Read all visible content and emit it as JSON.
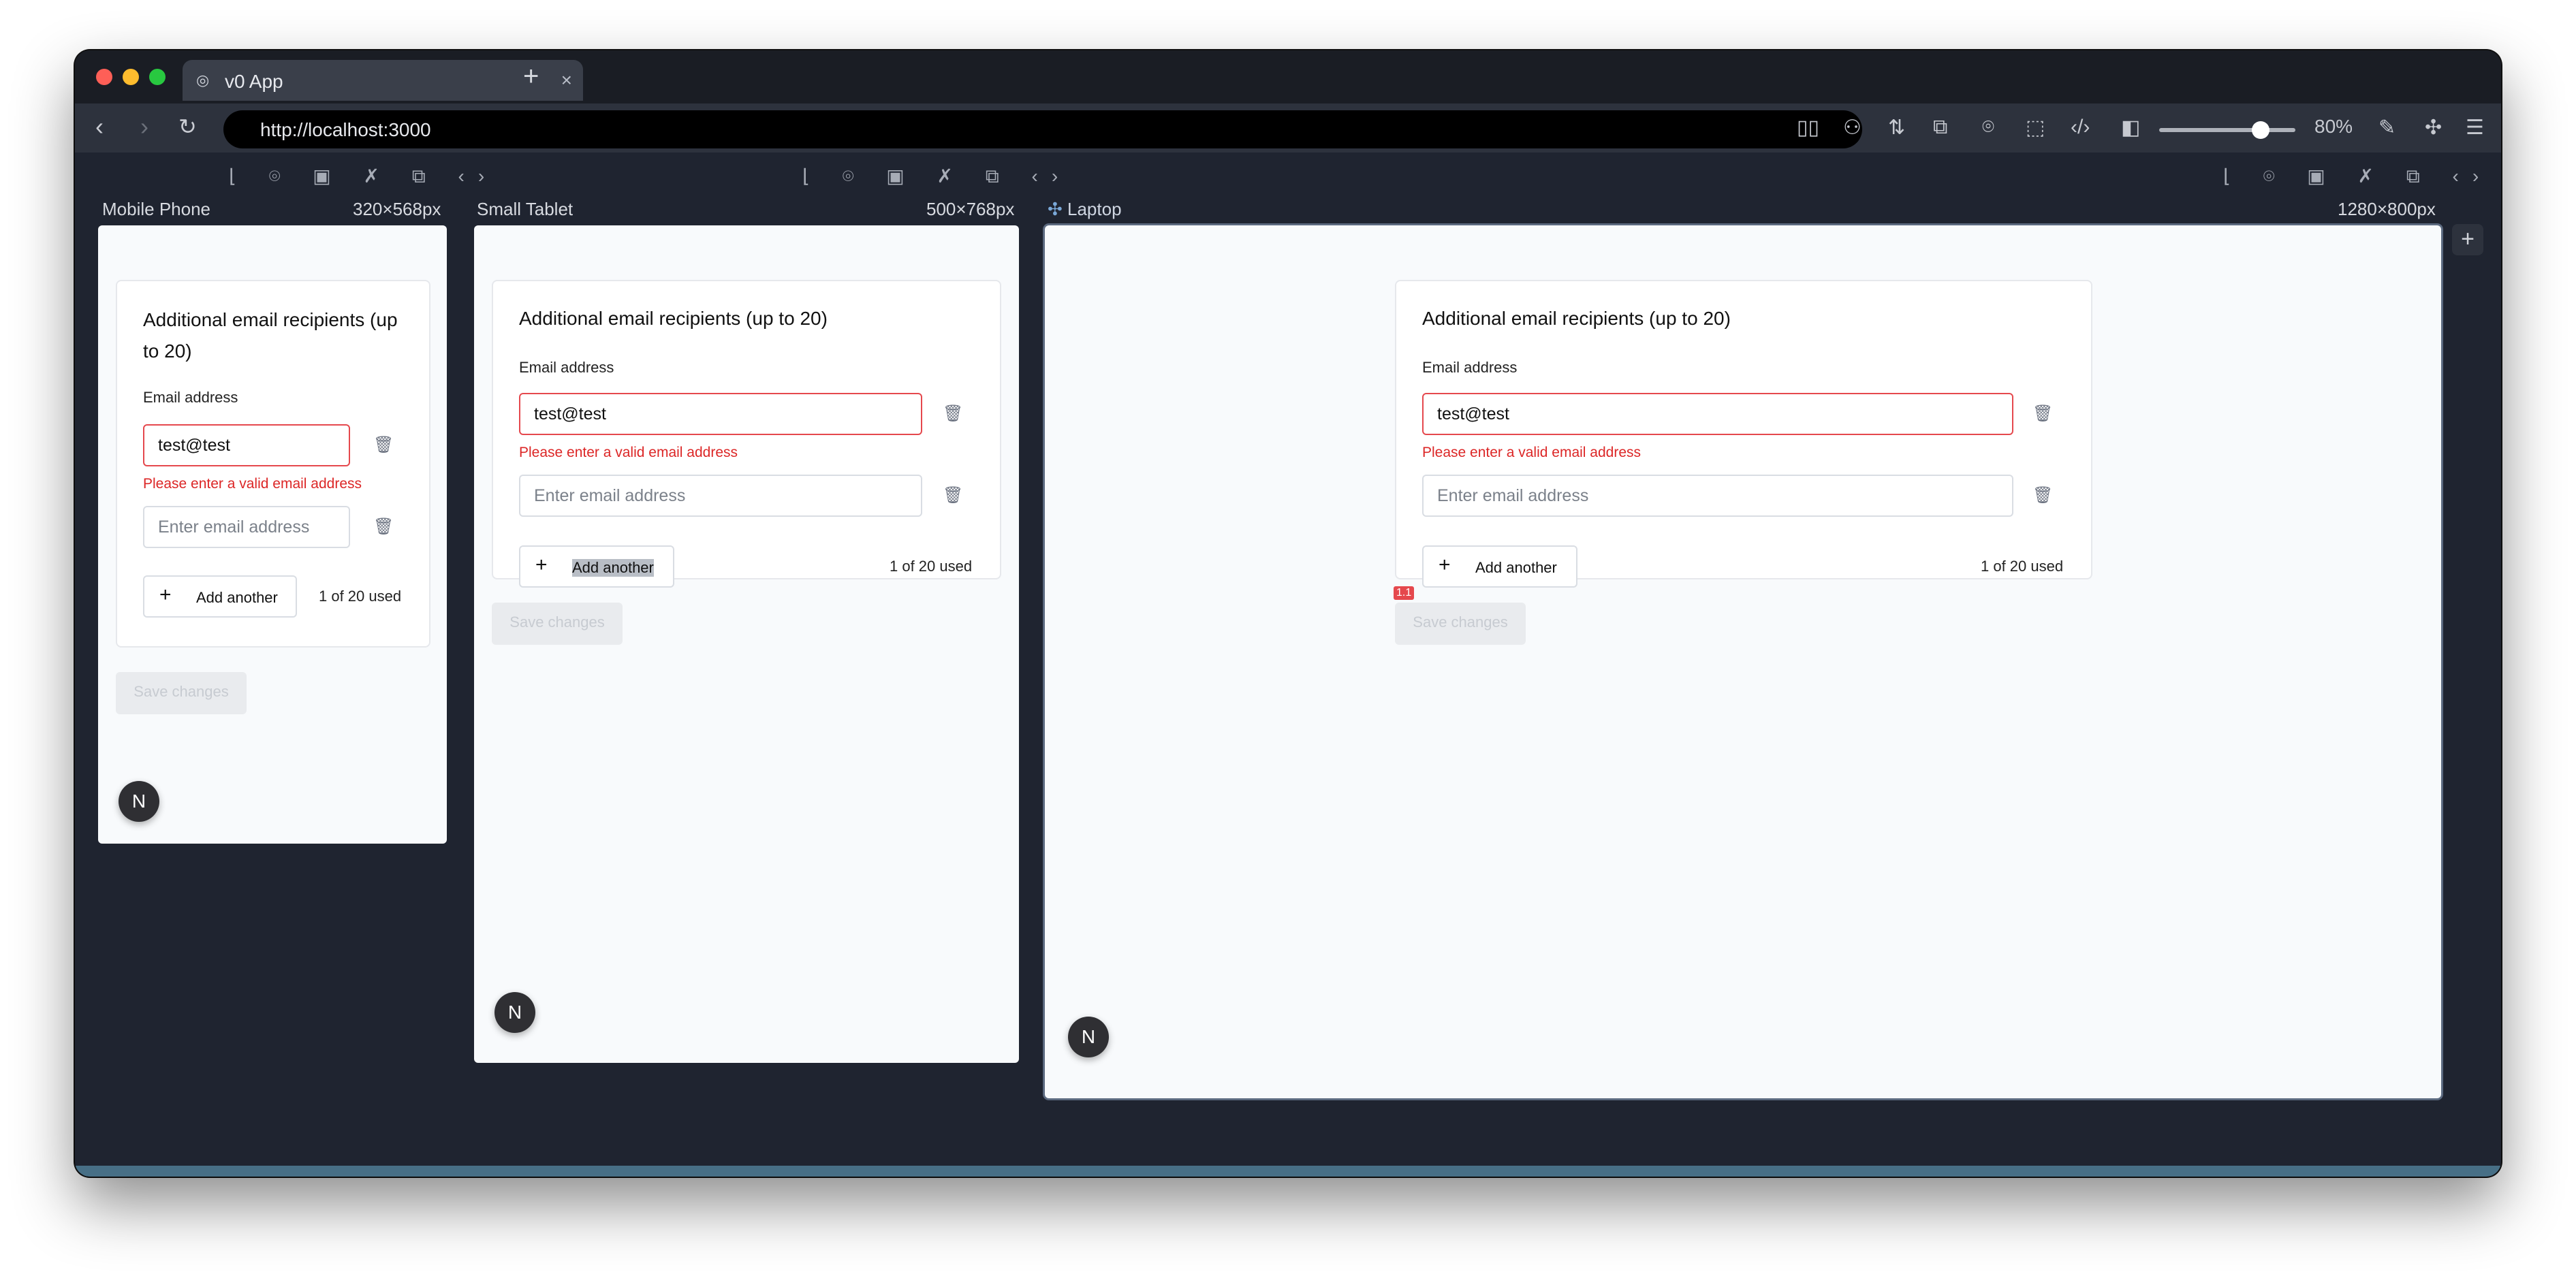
{
  "browser": {
    "tab_title": "v0 App",
    "tab_close": "×",
    "new_tab": "+",
    "url": "http://localhost:3000",
    "zoom": "80%"
  },
  "devices": [
    {
      "name": "Mobile Phone",
      "size": "320×568px"
    },
    {
      "name": "Small Tablet",
      "size": "500×768px"
    },
    {
      "name": "Laptop",
      "size": "1280×800px"
    }
  ],
  "form": {
    "title": "Additional email recipients (up to 20)",
    "label": "Email address",
    "value": "test@test",
    "error": "Please enter a valid email address",
    "placeholder": "Enter email address",
    "add_label": "Add another",
    "count": "1 of 20 used",
    "save_label": "Save changes"
  },
  "marker": "1.1",
  "badge": "N"
}
